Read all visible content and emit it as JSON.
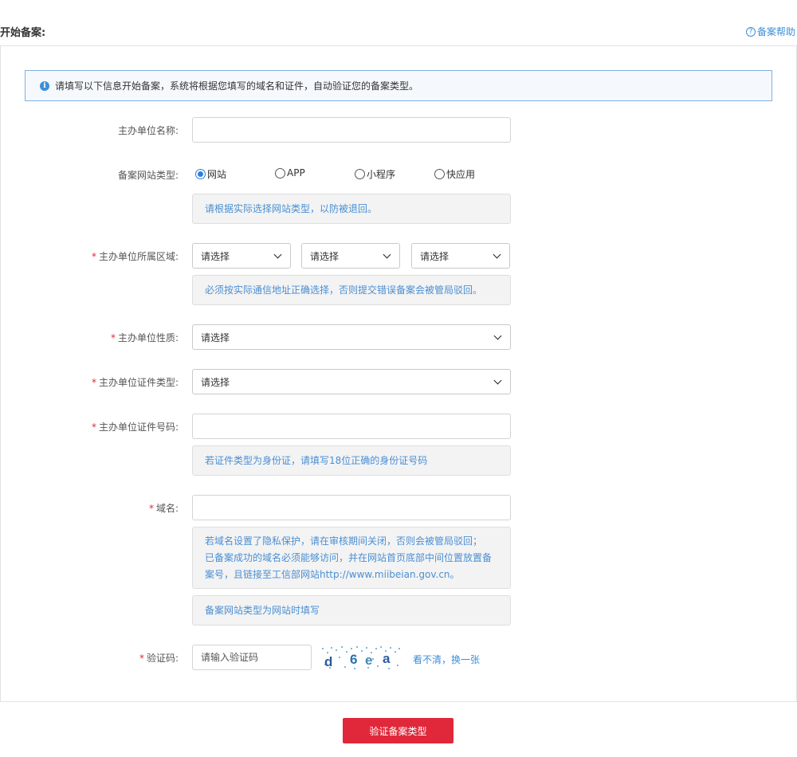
{
  "header": {
    "title": "开始备案:",
    "help_icon": "question-circle-icon",
    "help_label": "备案帮助"
  },
  "notice": {
    "icon": "info-icon",
    "icon_glyph": "i",
    "text": "请填写以下信息开始备案，系统将根据您填写的域名和证件，自动验证您的备案类型。"
  },
  "form": {
    "org_name": {
      "label": "主办单位名称:",
      "value": ""
    },
    "site_type": {
      "label": "备案网站类型:",
      "options": [
        "网站",
        "APP",
        "小程序",
        "快应用"
      ],
      "selected": "网站",
      "hint": "请根据实际选择网站类型，以防被退回。"
    },
    "region": {
      "required_mark": "*",
      "label": "主办单位所属区域:",
      "selects": [
        "请选择",
        "请选择",
        "请选择"
      ],
      "hint": "必须按实际通信地址正确选择，否则提交错误备案会被管局驳回。"
    },
    "org_nature": {
      "required_mark": "*",
      "label": "主办单位性质:",
      "value": "请选择"
    },
    "cert_type": {
      "required_mark": "*",
      "label": "主办单位证件类型:",
      "value": "请选择"
    },
    "cert_number": {
      "required_mark": "*",
      "label": "主办单位证件号码:",
      "value": "",
      "hint": "若证件类型为身份证，请填写18位正确的身份证号码"
    },
    "domain": {
      "required_mark": "*",
      "label": "域名:",
      "value": "",
      "hint_lines": [
        "若域名设置了隐私保护，请在审核期间关闭，否则会被管局驳回；",
        "已备案成功的域名必须能够访问，并在网站首页底部中间位置放置备",
        "案号，且链接至工信部网站http://www.miibeian.gov.cn。"
      ],
      "hint2": "备案网站类型为网站时填写"
    },
    "captcha": {
      "required_mark": "*",
      "label": "验证码:",
      "placeholder": "请输入验证码",
      "image_text": "d6ea",
      "refresh_label": "看不清，换一张"
    }
  },
  "submit_label": "验证备案类型",
  "colors": {
    "accent": "#e0283a",
    "link": "#3b8fd9",
    "hint_text": "#4a8fd3"
  }
}
